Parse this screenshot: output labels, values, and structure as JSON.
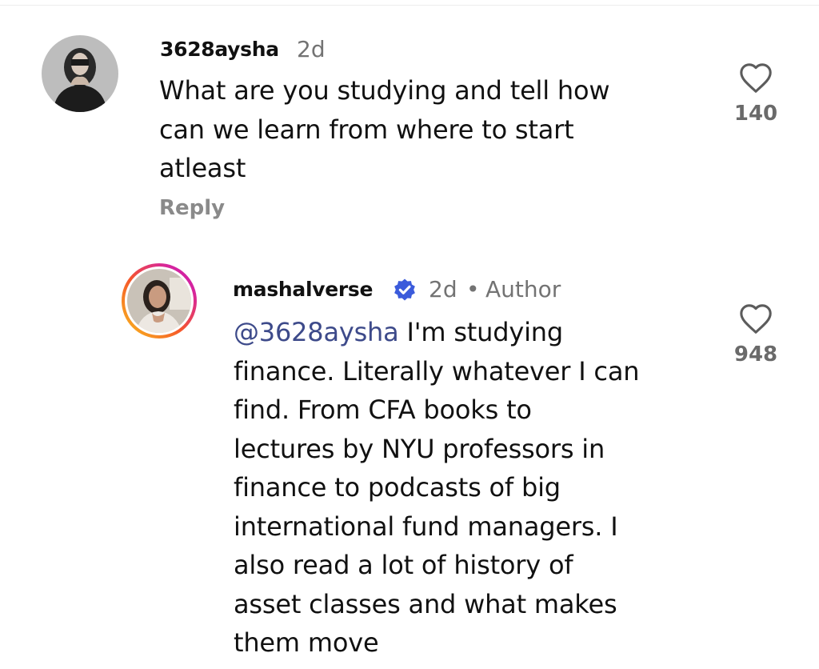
{
  "comments": [
    {
      "username": "3628aysha",
      "time": "2d",
      "lines": [
        "What are you studying and tell how",
        "can we learn from where to start",
        "atleast"
      ],
      "reply_label": "Reply",
      "likes": "140",
      "avatar_icon": "profile-photo-dark"
    },
    {
      "username": "mashalverse",
      "verified": true,
      "time": "2d",
      "separator": "•",
      "role": "Author",
      "mention": "@3628aysha",
      "first_line_rest": " I'm studying",
      "lines": [
        "finance. Literally whatever I can",
        "find. From CFA books to",
        "lectures by NYU professors in",
        "finance to podcasts of big",
        "international fund managers. I",
        "also read a lot of history of",
        "asset classes and what makes",
        "them move"
      ],
      "likes": "948",
      "avatar_icon": "profile-photo-story-ring"
    }
  ],
  "colors": {
    "text": "#111111",
    "meta": "#737373",
    "reply": "#8a8a8a",
    "mention": "#3d4a8a",
    "verified": "#3b5bdb"
  }
}
